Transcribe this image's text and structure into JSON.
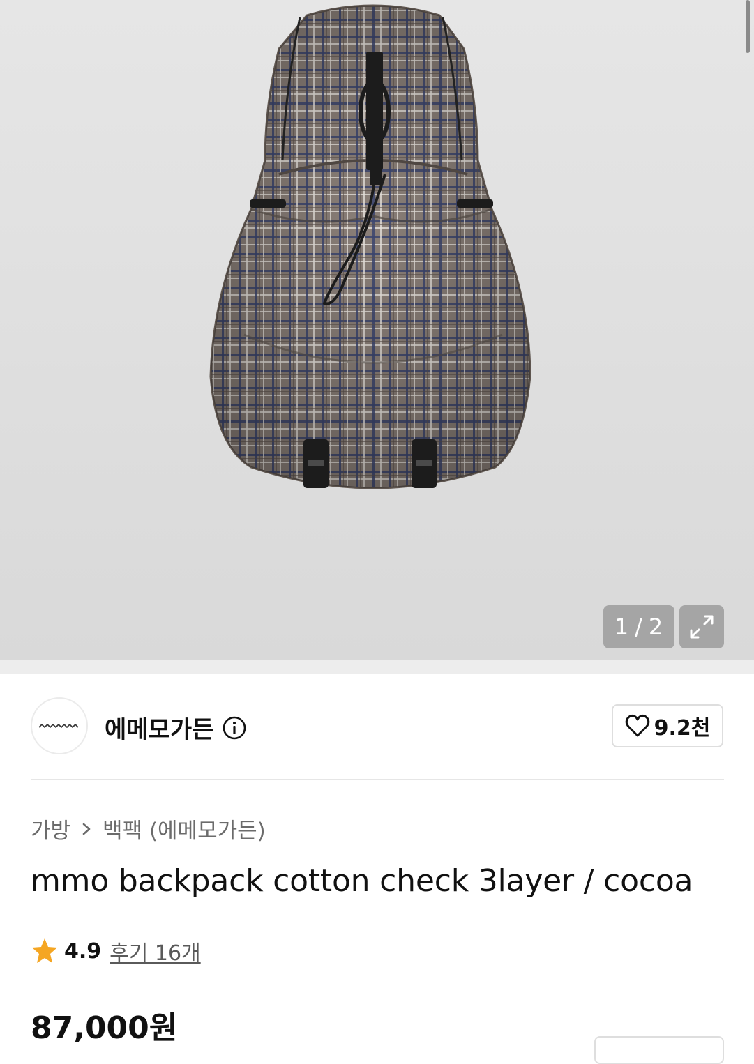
{
  "gallery": {
    "current": "1",
    "separator": "/",
    "total": "2",
    "image_alt": "mmo backpack cotton check 3layer / cocoa"
  },
  "brand": {
    "name": "에메모가든",
    "like_count": "9.2천"
  },
  "breadcrumb": {
    "category": "가방",
    "subcategory": "백팩 (에메모가든)"
  },
  "product": {
    "title": "mmo backpack cotton check 3layer / cocoa",
    "rating": "4.9",
    "review_label": "후기 16개",
    "price": "87,000원"
  },
  "colors": {
    "star": "#f5a623",
    "fabric": "#8b8079",
    "check_blue": "#3b4570",
    "strap": "#1c1c1c"
  }
}
